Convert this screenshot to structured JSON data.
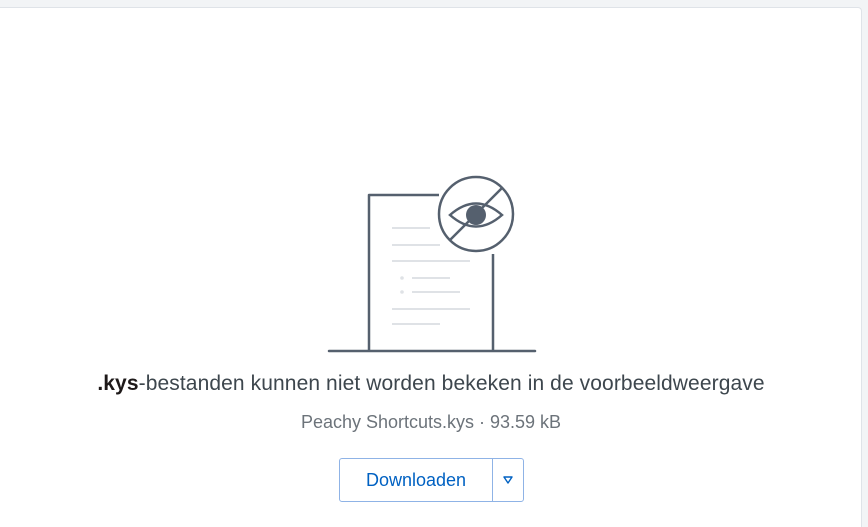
{
  "preview": {
    "extension": ".kys",
    "message_rest": "-bestanden kunnen niet worden bekeken in de voorbeeldweergave",
    "file_info": "Peachy Shortcuts.kys · 93.59 kB",
    "illustration_icon": "document-no-preview-icon"
  },
  "actions": {
    "download_label": "Downloaden",
    "more_icon": "triangle-down-icon"
  },
  "colors": {
    "accent": "#0061c2",
    "button_border": "#8fb3e6",
    "text": "#3d464d",
    "muted_text": "#6c737a",
    "illustration_stroke": "#55606e"
  }
}
